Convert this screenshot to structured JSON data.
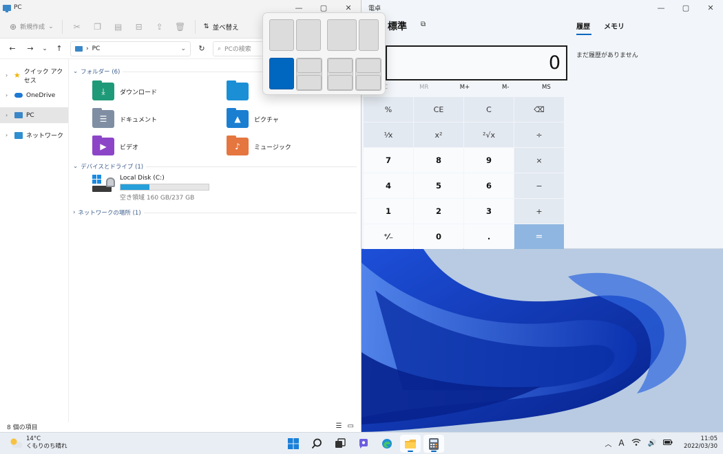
{
  "explorer": {
    "title": "PC",
    "toolbar": {
      "new_label": "新規作成",
      "sort_label": "並べ替え"
    },
    "address": "PC",
    "search_placeholder": "PCの検索",
    "sidebar": [
      {
        "label": "クイック アクセス",
        "icon": "star-icon",
        "selected": false
      },
      {
        "label": "OneDrive",
        "icon": "cloud-icon",
        "selected": false
      },
      {
        "label": "PC",
        "icon": "computer-icon",
        "selected": true
      },
      {
        "label": "ネットワーク",
        "icon": "network-icon",
        "selected": false
      }
    ],
    "folders_header": "フォルダー (6)",
    "folders": [
      {
        "label": "ダウンロード",
        "icon": "download-folder-icon",
        "color": "#1f9a78"
      },
      {
        "label": "",
        "icon": "desktop-folder-icon",
        "color": "#1a8fd6"
      },
      {
        "label": "ドキュメント",
        "icon": "documents-folder-icon",
        "color": "#7f8ea3"
      },
      {
        "label": "ピクチャ",
        "icon": "pictures-folder-icon",
        "color": "#1b7fd1"
      },
      {
        "label": "ビデオ",
        "icon": "videos-folder-icon",
        "color": "#8d45c8"
      },
      {
        "label": "ミュージック",
        "icon": "music-folder-icon",
        "color": "#e5763f"
      }
    ],
    "drives_header": "デバイスとドライブ (1)",
    "drive": {
      "name": "Local Disk (C:)",
      "free_text": "空き領域 160 GB/237 GB",
      "used_fraction": 0.325
    },
    "network_header": "ネットワークの場所 (1)",
    "status": "8 個の項目"
  },
  "calculator": {
    "title": "電卓",
    "mode": "標準",
    "display": "0",
    "memory": [
      {
        "label": "MC",
        "disabled": true
      },
      {
        "label": "MR",
        "disabled": true
      },
      {
        "label": "M+",
        "disabled": false
      },
      {
        "label": "M-",
        "disabled": false
      },
      {
        "label": "MS",
        "disabled": false
      }
    ],
    "keys": [
      {
        "label": "%",
        "kind": "op",
        "name": "percent-key"
      },
      {
        "label": "CE",
        "kind": "op",
        "name": "clear-entry-key"
      },
      {
        "label": "C",
        "kind": "op",
        "name": "clear-key"
      },
      {
        "label": "⌫",
        "kind": "op",
        "name": "backspace-key"
      },
      {
        "label": "¹⁄x",
        "kind": "op",
        "name": "reciprocal-key"
      },
      {
        "label": "x²",
        "kind": "op",
        "name": "square-key"
      },
      {
        "label": "²√x",
        "kind": "op",
        "name": "square-root-key"
      },
      {
        "label": "÷",
        "kind": "op",
        "name": "divide-key"
      },
      {
        "label": "7",
        "kind": "num",
        "name": "digit-7-key"
      },
      {
        "label": "8",
        "kind": "num",
        "name": "digit-8-key"
      },
      {
        "label": "9",
        "kind": "num",
        "name": "digit-9-key"
      },
      {
        "label": "×",
        "kind": "op",
        "name": "multiply-key"
      },
      {
        "label": "4",
        "kind": "num",
        "name": "digit-4-key"
      },
      {
        "label": "5",
        "kind": "num",
        "name": "digit-5-key"
      },
      {
        "label": "6",
        "kind": "num",
        "name": "digit-6-key"
      },
      {
        "label": "−",
        "kind": "op",
        "name": "subtract-key"
      },
      {
        "label": "1",
        "kind": "num",
        "name": "digit-1-key"
      },
      {
        "label": "2",
        "kind": "num",
        "name": "digit-2-key"
      },
      {
        "label": "3",
        "kind": "num",
        "name": "digit-3-key"
      },
      {
        "label": "+",
        "kind": "op",
        "name": "add-key"
      },
      {
        "label": "⁺⁄₋",
        "kind": "num",
        "name": "negate-key"
      },
      {
        "label": "0",
        "kind": "num",
        "name": "digit-0-key"
      },
      {
        "label": ".",
        "kind": "num",
        "name": "decimal-key"
      },
      {
        "label": "=",
        "kind": "eq",
        "name": "equals-key"
      }
    ],
    "history_tab": "履歴",
    "memory_tab": "メモリ",
    "history_empty": "まだ履歴がありません"
  },
  "taskbar": {
    "weather_temp": "14°C",
    "weather_desc": "くもりのち晴れ",
    "time": "11:05",
    "date": "2022/03/30",
    "ime": "A",
    "apps": [
      "windows-start-icon",
      "search-icon",
      "task-view-icon",
      "chat-icon",
      "edge-icon",
      "file-explorer-icon",
      "calculator-icon"
    ],
    "active_apps": [
      "file-explorer-icon",
      "calculator-icon"
    ]
  },
  "colors": {
    "accent": "#0067c0",
    "drive_bar": "#26a0da"
  }
}
